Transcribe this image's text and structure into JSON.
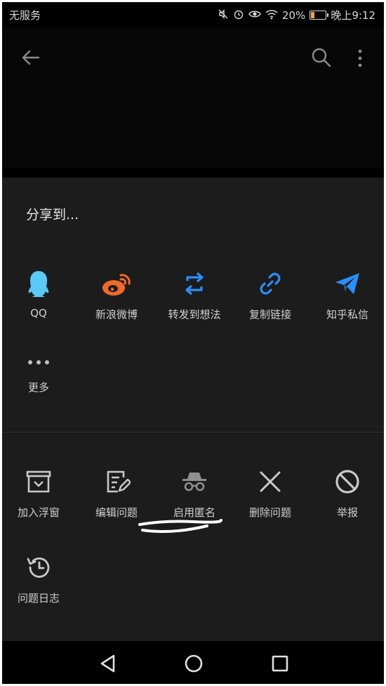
{
  "status_bar": {
    "carrier": "无服务",
    "battery_percent": "20%",
    "time": "晚上9:12",
    "icons": [
      "mute-icon",
      "alarm-icon",
      "eye-comfort-icon",
      "wifi-icon",
      "battery-icon"
    ]
  },
  "app_bar": {
    "icons": [
      "back-arrow-icon",
      "search-icon",
      "overflow-menu-icon"
    ]
  },
  "share_sheet": {
    "title": "分享到...",
    "share_targets": [
      {
        "label": "QQ",
        "icon": "qq-icon",
        "color": "#5bc8f5"
      },
      {
        "label": "新浪微博",
        "icon": "weibo-icon",
        "color": "#f0692c"
      },
      {
        "label": "转发到想法",
        "icon": "repost-icon",
        "color": "#2a8ff7"
      },
      {
        "label": "复制链接",
        "icon": "link-icon",
        "color": "#2a8ff7"
      },
      {
        "label": "知乎私信",
        "icon": "send-icon",
        "color": "#2a8ff7"
      },
      {
        "label": "更多",
        "icon": "more-dots-icon",
        "color": "#bfbfbf"
      }
    ],
    "actions": [
      {
        "label": "加入浮窗",
        "icon": "floating-window-icon"
      },
      {
        "label": "编辑问题",
        "icon": "edit-icon"
      },
      {
        "label": "启用匿名",
        "icon": "anonymous-icon"
      },
      {
        "label": "删除问题",
        "icon": "close-icon"
      },
      {
        "label": "举报",
        "icon": "block-icon"
      },
      {
        "label": "问题日志",
        "icon": "history-icon"
      }
    ],
    "icon_gray": "#c9c9c9"
  },
  "nav_bar": {
    "icons": [
      "nav-back-icon",
      "nav-home-icon",
      "nav-recents-icon"
    ]
  }
}
